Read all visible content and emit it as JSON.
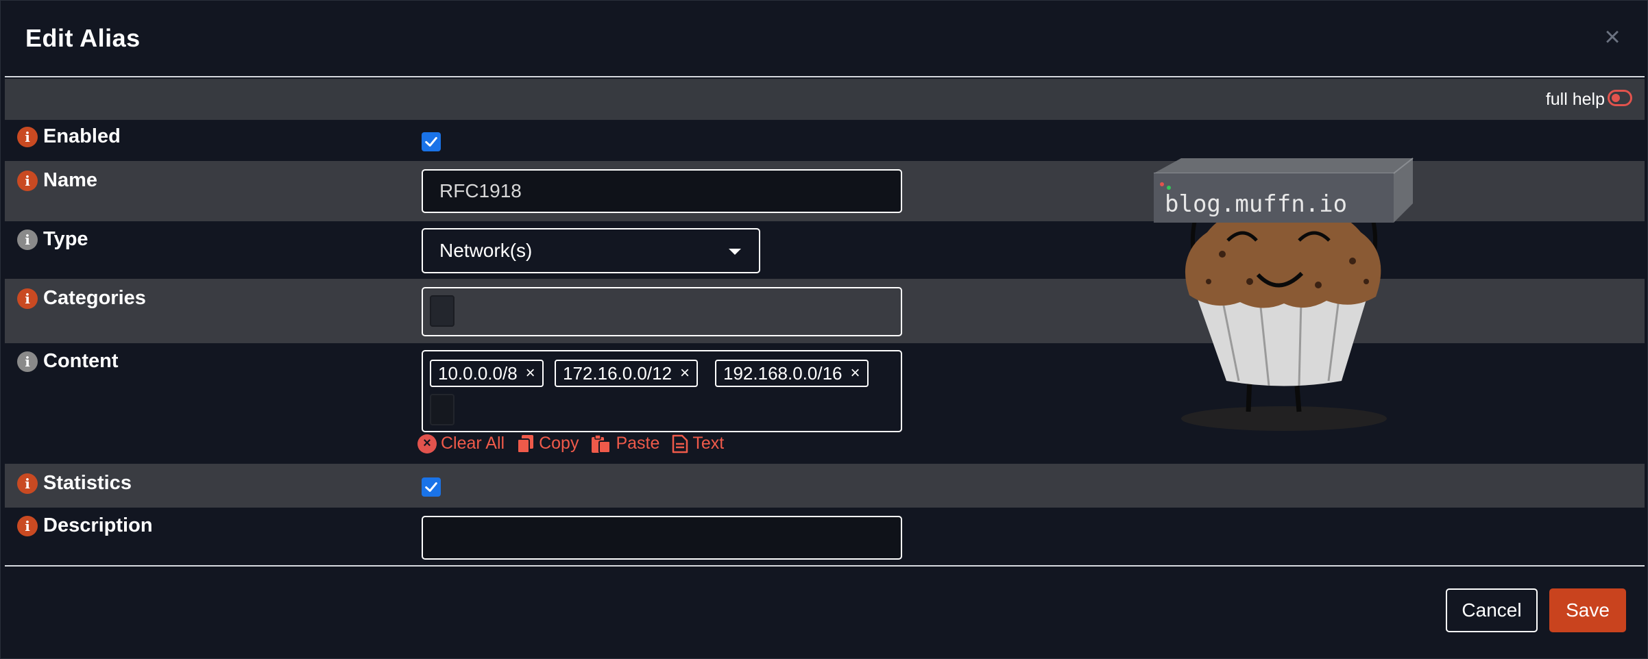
{
  "modal": {
    "title": "Edit Alias",
    "close_symbol": "×"
  },
  "help": {
    "label": "full help"
  },
  "fields": {
    "enabled": {
      "label": "Enabled",
      "checked": true
    },
    "name": {
      "label": "Name",
      "value": "RFC1918"
    },
    "type": {
      "label": "Type",
      "selected": "Network(s)"
    },
    "categories": {
      "label": "Categories"
    },
    "content": {
      "label": "Content",
      "tags": [
        "10.0.0.0/8",
        "172.16.0.0/12",
        "192.168.0.0/16"
      ],
      "actions": {
        "clear_all": "Clear All",
        "copy": "Copy",
        "paste": "Paste",
        "text": "Text"
      }
    },
    "statistics": {
      "label": "Statistics",
      "checked": true
    },
    "description": {
      "label": "Description",
      "value": ""
    }
  },
  "buttons": {
    "cancel": "Cancel",
    "save": "Save"
  },
  "watermark": {
    "text": "blog.muffn.io"
  },
  "colors": {
    "accent_red": "#c9431e",
    "link_red": "#ef5a4a",
    "checkbox_blue": "#1a73e8",
    "info_grey": "#8a8a8a"
  }
}
